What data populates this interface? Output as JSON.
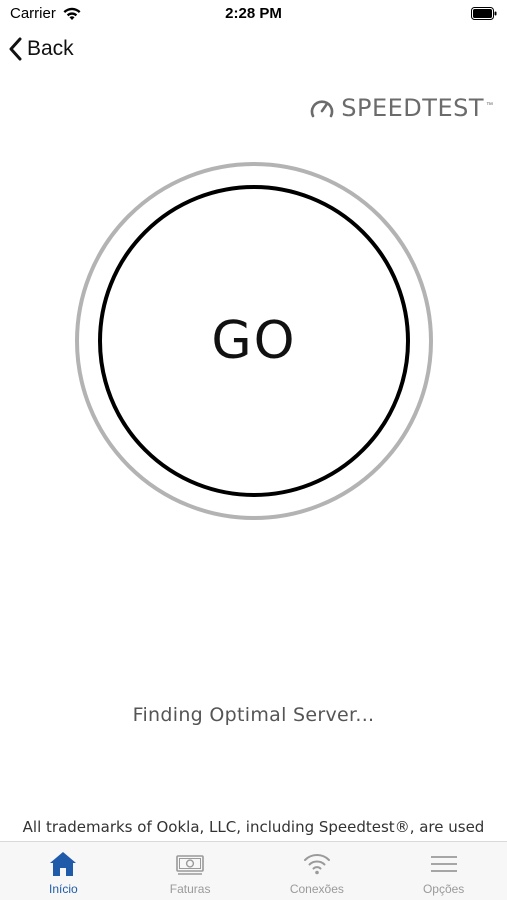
{
  "status_bar": {
    "carrier": "Carrier",
    "time": "2:28 PM"
  },
  "nav": {
    "back_label": "Back"
  },
  "brand": {
    "logo_text": "SPEEDTEST",
    "trademark_mark": "™"
  },
  "speedtest": {
    "go_label": "GO",
    "status_text": "Finding Optimal Server..."
  },
  "footer": {
    "trademark_notice": "All trademarks of Ookla, LLC, including Speedtest®, are used"
  },
  "tabs": [
    {
      "label": "Início",
      "icon": "home-icon",
      "active": true
    },
    {
      "label": "Faturas",
      "icon": "bill-icon",
      "active": false
    },
    {
      "label": "Conexões",
      "icon": "wifi-icon",
      "active": false
    },
    {
      "label": "Opções",
      "icon": "menu-icon",
      "active": false
    }
  ],
  "colors": {
    "active_tab": "#1f5ba8",
    "inactive_tab": "#9a9a9a",
    "outer_ring": "#b3b3b3",
    "inner_ring": "#000000"
  }
}
